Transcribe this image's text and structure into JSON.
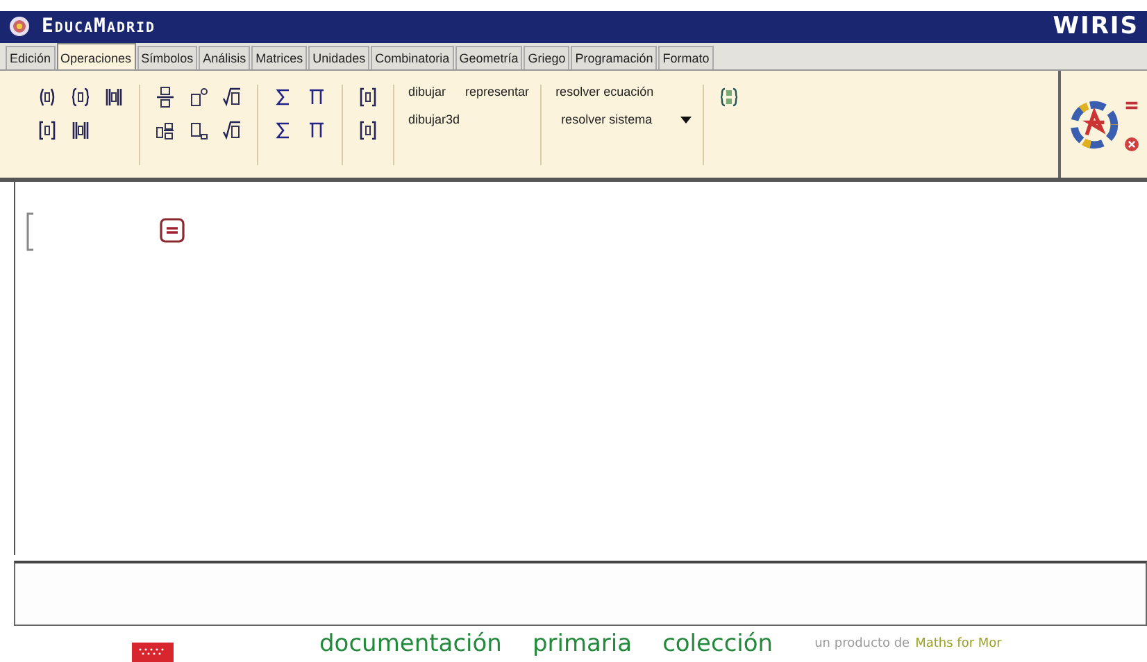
{
  "header": {
    "brand": "EducaMadrid",
    "product": "WIRIS"
  },
  "tabs": [
    {
      "label": "Edición",
      "selected": false
    },
    {
      "label": "Operaciones",
      "selected": true
    },
    {
      "label": "Símbolos",
      "selected": false
    },
    {
      "label": "Análisis",
      "selected": false
    },
    {
      "label": "Matrices",
      "selected": false
    },
    {
      "label": "Unidades",
      "selected": false
    },
    {
      "label": "Combinatoria",
      "selected": false
    },
    {
      "label": "Geometría",
      "selected": false
    },
    {
      "label": "Griego",
      "selected": false
    },
    {
      "label": "Programación",
      "selected": false
    },
    {
      "label": "Formato",
      "selected": false
    }
  ],
  "toolbar": {
    "plot_commands": [
      "dibujar",
      "representar",
      "dibujar3d"
    ],
    "solve_commands": [
      "resolver ecuación",
      "resolver sistema"
    ]
  },
  "footer": {
    "links": [
      "documentación",
      "primaria",
      "colección"
    ],
    "credit": "un producto de",
    "credit_link": "Maths for Mor"
  }
}
